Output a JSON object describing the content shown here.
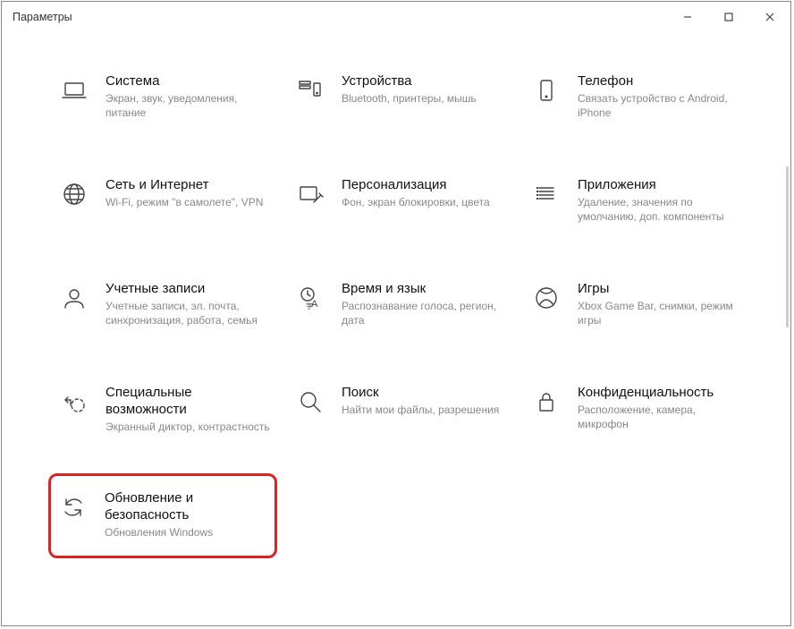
{
  "window": {
    "title": "Параметры"
  },
  "tiles": [
    {
      "key": "system",
      "title": "Система",
      "desc": "Экран, звук, уведомления, питание",
      "icon": "laptop-icon"
    },
    {
      "key": "devices",
      "title": "Устройства",
      "desc": "Bluetooth, принтеры, мышь",
      "icon": "devices-icon"
    },
    {
      "key": "phone",
      "title": "Телефон",
      "desc": "Связать устройство с Android, iPhone",
      "icon": "phone-icon"
    },
    {
      "key": "network",
      "title": "Сеть и Интернет",
      "desc": "Wi-Fi, режим \"в самолете\", VPN",
      "icon": "globe-icon"
    },
    {
      "key": "personalization",
      "title": "Персонализация",
      "desc": "Фон, экран блокировки, цвета",
      "icon": "pen-screen-icon"
    },
    {
      "key": "apps",
      "title": "Приложения",
      "desc": "Удаление, значения по умолчанию, доп. компоненты",
      "icon": "apps-icon"
    },
    {
      "key": "accounts",
      "title": "Учетные записи",
      "desc": "Учетные записи, эл. почта, синхронизация, работа, семья",
      "icon": "person-icon"
    },
    {
      "key": "time",
      "title": "Время и язык",
      "desc": "Распознавание голоса, регион, дата",
      "icon": "time-lang-icon"
    },
    {
      "key": "gaming",
      "title": "Игры",
      "desc": "Xbox Game Bar, снимки, режим игры",
      "icon": "xbox-icon"
    },
    {
      "key": "accessibility",
      "title": "Специальные возможности",
      "desc": "Экранный диктор, контрастность",
      "icon": "accessibility-icon"
    },
    {
      "key": "search",
      "title": "Поиск",
      "desc": "Найти мои файлы, разрешения",
      "icon": "search-icon"
    },
    {
      "key": "privacy",
      "title": "Конфиденциальность",
      "desc": "Расположение, камера, микрофон",
      "icon": "lock-icon"
    },
    {
      "key": "update",
      "title": "Обновление и безопасность",
      "desc": "Обновления Windows",
      "icon": "sync-icon",
      "highlighted": true
    }
  ]
}
